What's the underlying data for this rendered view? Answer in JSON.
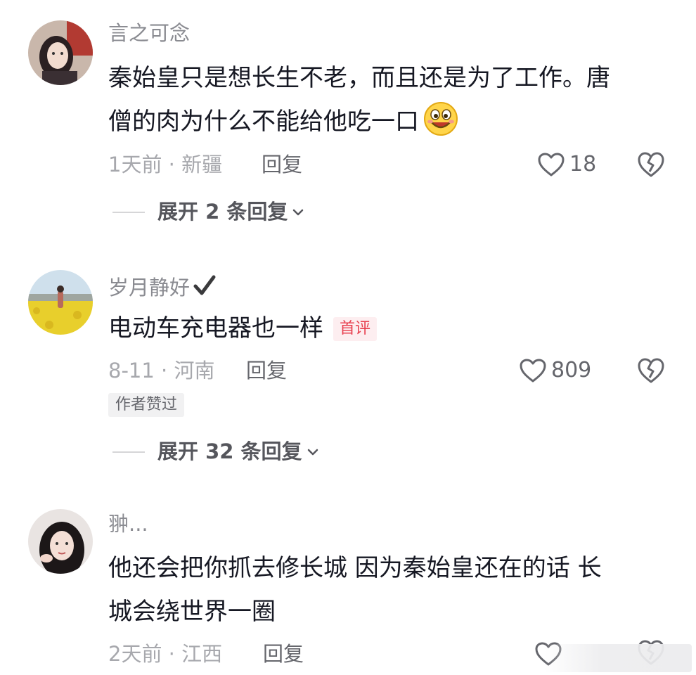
{
  "comments": [
    {
      "username": "言之可念",
      "verified": false,
      "text_lines": [
        "秦始皇只是想长生不老，而且还是为了工作。唐",
        "僧的肉为什么不能给他吃一口"
      ],
      "trailing_emoji": "smile-emoji",
      "time": "1天前",
      "location": "新疆",
      "meta": "1天前 · 新疆",
      "reply_label": "回复",
      "like_count": "18",
      "badge": "",
      "author_liked": "",
      "expand_label": "展开 2 条回复"
    },
    {
      "username": "岁月静好",
      "verified": true,
      "text_lines": [
        "电动车充电器也一样"
      ],
      "trailing_emoji": "",
      "time": "8-11",
      "location": "河南",
      "meta": "8-11 · 河南",
      "reply_label": "回复",
      "like_count": "809",
      "badge": "首评",
      "author_liked": "作者赞过",
      "expand_label": "展开 32 条回复"
    },
    {
      "username": "翀...",
      "verified": false,
      "text_lines": [
        "他还会把你抓去修长城 因为秦始皇还在的话 长",
        "城会绕世界一圈"
      ],
      "trailing_emoji": "",
      "time": "2天前",
      "location": "江西",
      "meta": "2天前 · 江西",
      "reply_label": "回复",
      "like_count": "",
      "badge": "",
      "author_liked": "",
      "expand_label": ""
    }
  ],
  "colors": {
    "text": "#161823",
    "username": "#8a8b91",
    "meta": "#a7a8ad",
    "badge_bg": "#fdeef0",
    "badge_text": "#e8404f"
  }
}
